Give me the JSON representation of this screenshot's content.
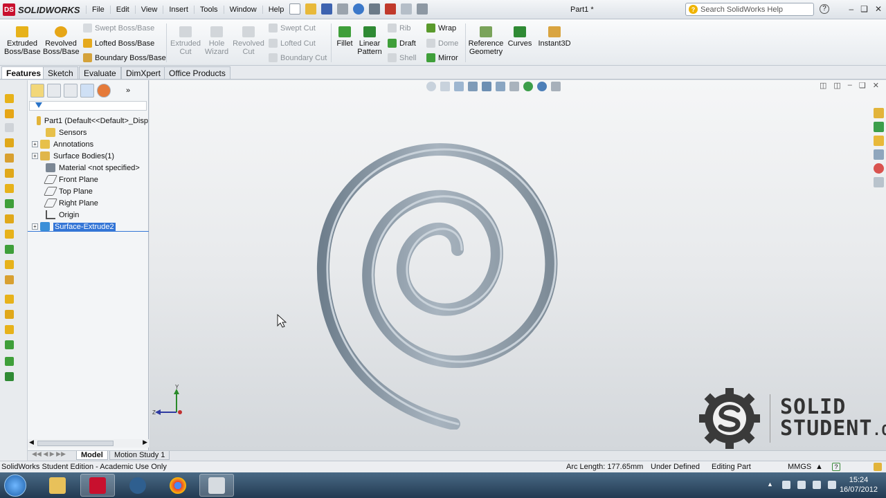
{
  "app": {
    "brand": "SOLIDWORKS",
    "doc_title": "Part1 *",
    "menus": [
      "File",
      "Edit",
      "View",
      "Insert",
      "Tools",
      "Window",
      "Help"
    ],
    "search_placeholder": "Search SolidWorks Help"
  },
  "ribbon": {
    "extruded_boss": "Extruded Boss/Base",
    "revolved_boss": "Revolved Boss/Base",
    "swept_boss": "Swept Boss/Base",
    "lofted_boss": "Lofted Boss/Base",
    "boundary_boss": "Boundary Boss/Base",
    "extruded_cut": "Extruded Cut",
    "hole_wizard": "Hole Wizard",
    "revolved_cut": "Revolved Cut",
    "swept_cut": "Swept Cut",
    "lofted_cut": "Lofted Cut",
    "boundary_cut": "Boundary Cut",
    "fillet": "Fillet",
    "linear_pattern": "Linear Pattern",
    "rib": "Rib",
    "draft": "Draft",
    "shell": "Shell",
    "wrap": "Wrap",
    "dome": "Dome",
    "mirror": "Mirror",
    "reference_geometry": "Reference Geometry",
    "curves": "Curves",
    "instant3d": "Instant3D"
  },
  "tabs": [
    "Features",
    "Sketch",
    "Evaluate",
    "DimXpert",
    "Office Products"
  ],
  "tree": {
    "root": "Part1  (Default<<Default>_Disp",
    "items": [
      {
        "label": "Sensors",
        "expandable": false
      },
      {
        "label": "Annotations",
        "expandable": true
      },
      {
        "label": "Surface Bodies(1)",
        "expandable": true
      },
      {
        "label": "Material <not specified>",
        "expandable": false
      },
      {
        "label": "Front Plane",
        "expandable": false
      },
      {
        "label": "Top Plane",
        "expandable": false
      },
      {
        "label": "Right Plane",
        "expandable": false
      },
      {
        "label": "Origin",
        "expandable": false
      },
      {
        "label": "Surface-Extrude2",
        "expandable": true,
        "selected": true
      }
    ]
  },
  "viewport": {
    "triad_y": "Y",
    "triad_z": "Z"
  },
  "watermark": {
    "line1": "SOLID",
    "line2": "STUDENT",
    "suffix": ".ORG"
  },
  "bottom_tabs": [
    "Model",
    "Motion Study 1"
  ],
  "status": {
    "edition": "SolidWorks Student Edition - Academic Use Only",
    "arc_length": "Arc Length: 177.65mm",
    "definition": "Under Defined",
    "mode": "Editing Part",
    "units": "MMGS"
  },
  "clock": {
    "time": "15:24",
    "date": "16/07/2012"
  },
  "colors": {
    "selection": "#3375d6",
    "brand_red": "#c8102e",
    "spiral": "#8d9aa5"
  }
}
